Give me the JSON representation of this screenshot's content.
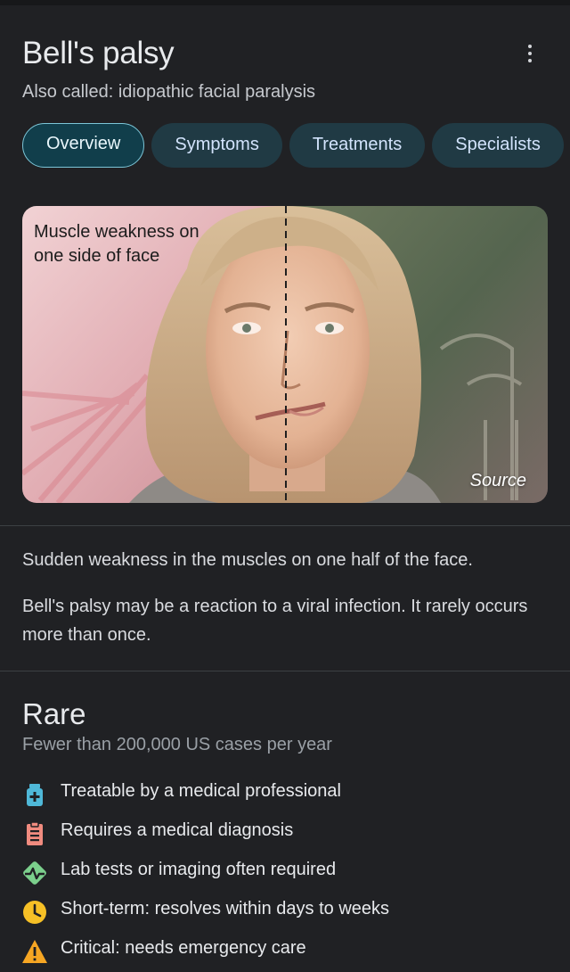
{
  "header": {
    "title": "Bell's palsy",
    "subtitle": "Also called: idiopathic facial paralysis"
  },
  "tabs": [
    {
      "label": "Overview",
      "active": true
    },
    {
      "label": "Symptoms",
      "active": false
    },
    {
      "label": "Treatments",
      "active": false
    },
    {
      "label": "Specialists",
      "active": false
    }
  ],
  "hero": {
    "caption": "Muscle weakness on one side of face",
    "source_label": "Source"
  },
  "description": {
    "summary": "Sudden weakness in the muscles on one half of the face.",
    "detail": "Bell's palsy may be a reaction to a viral infection. It rarely occurs more than once."
  },
  "rarity": {
    "label": "Rare",
    "detail": "Fewer than 200,000 US cases per year"
  },
  "facts": [
    {
      "icon": "medicine-bottle-icon",
      "color": "#4fb8d8",
      "text": "Treatable by a medical professional"
    },
    {
      "icon": "clipboard-icon",
      "color": "#f08b7f",
      "text": "Requires a medical diagnosis"
    },
    {
      "icon": "heartbeat-icon",
      "color": "#7bcf8c",
      "text": "Lab tests or imaging often required"
    },
    {
      "icon": "clock-icon",
      "color": "#f6c026",
      "text": "Short-term: resolves within days to weeks"
    },
    {
      "icon": "warning-icon",
      "color": "#f6a623",
      "text": "Critical: needs emergency care"
    }
  ]
}
